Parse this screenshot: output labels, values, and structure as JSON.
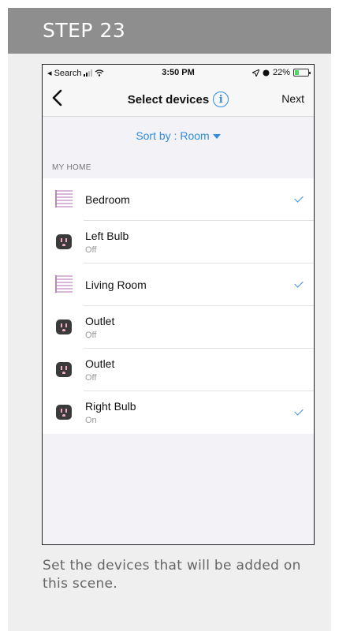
{
  "step": {
    "title": "STEP 23"
  },
  "status_bar": {
    "back_app": "◂ Search",
    "time": "3:50 PM",
    "battery_text": "22%"
  },
  "nav": {
    "title": "Select devices",
    "info_glyph": "i",
    "next_label": "Next"
  },
  "sort": {
    "label": "Sort by : Room"
  },
  "section": {
    "label": "MY HOME"
  },
  "devices": [
    {
      "name": "Bedroom",
      "status": "",
      "icon": "room-icon",
      "selected": true
    },
    {
      "name": "Left Bulb",
      "status": "Off",
      "icon": "outlet-icon",
      "selected": false
    },
    {
      "name": "Living Room",
      "status": "",
      "icon": "room-icon",
      "selected": true
    },
    {
      "name": "Outlet",
      "status": "Off",
      "icon": "outlet-icon",
      "selected": false
    },
    {
      "name": "Outlet",
      "status": "Off",
      "icon": "outlet-icon",
      "selected": false
    },
    {
      "name": "Right Bulb",
      "status": "On",
      "icon": "outlet-icon",
      "selected": true
    }
  ],
  "caption": {
    "text": "Set the devices that will be added on this scene."
  },
  "colors": {
    "accent": "#2f8de0",
    "header_bg": "#8e8e8e",
    "card_bg": "#efefef",
    "room_icon": "#d9b7d9",
    "outlet_icon": "#3a3a3a"
  }
}
